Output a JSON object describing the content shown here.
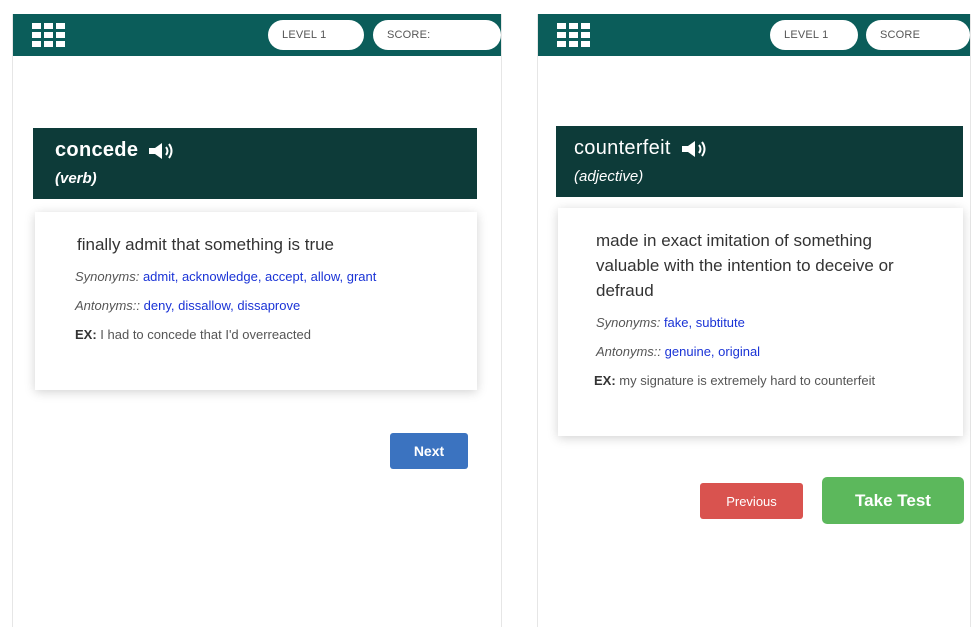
{
  "left": {
    "level_label": "LEVEL 1",
    "score_label": "SCORE:",
    "word": "concede",
    "pos": "(verb)",
    "definition": "finally admit that something is true",
    "synonyms_label": "Synonyms:",
    "synonyms": "admit, acknowledge, accept, allow, grant",
    "antonyms_label": "Antonyms::",
    "antonyms": "deny, dissallow, dissaprove",
    "ex_label": "EX:",
    "example": "I had to concede that I'd overreacted",
    "next_label": "Next"
  },
  "right": {
    "level_label": "LEVEL 1",
    "score_label": "SCORE",
    "word": "counterfeit",
    "pos": "(adjective)",
    "definition": "made in exact imitation of something valuable with the intention to deceive or defraud",
    "synonyms_label": "Synonyms:",
    "synonyms": "fake, subtitute",
    "antonyms_label": "Antonyms::",
    "antonyms": "genuine, original",
    "ex_label": "EX:",
    "example": "my signature is extremely hard to counterfeit",
    "previous_label": "Previous",
    "take_test_label": "Take Test"
  },
  "colors": {
    "topbar": "#0b5d5a",
    "word_card": "#0d3b39",
    "link": "#1a33d6",
    "next_button": "#3b73c0",
    "previous_button": "#d9534f",
    "take_test_button": "#5cb85c"
  },
  "icons": {
    "menu": "grid-menu-icon",
    "audio": "speaker-icon"
  }
}
